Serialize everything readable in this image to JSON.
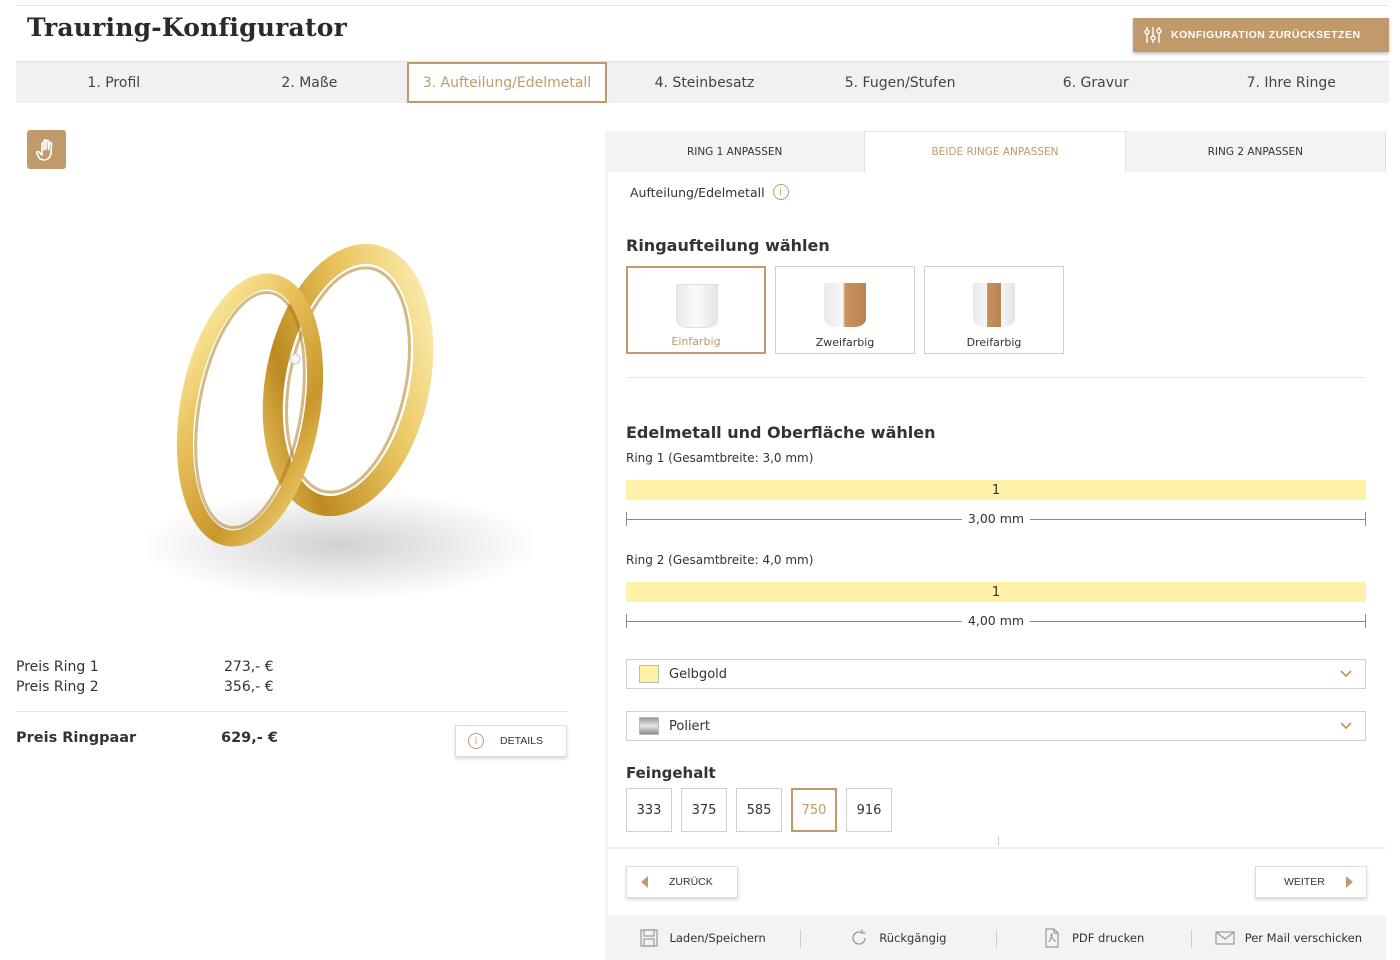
{
  "header": {
    "title": "Trauring-Konfigurator",
    "reset_label": "KONFIGURATION ZURÜCKSETZEN"
  },
  "steps": [
    {
      "label": "1. Profil",
      "active": false
    },
    {
      "label": "2. Maße",
      "active": false
    },
    {
      "label": "3. Aufteilung/Edelmetall",
      "active": true
    },
    {
      "label": "4. Steinbesatz",
      "active": false
    },
    {
      "label": "5. Fugen/Stufen",
      "active": false
    },
    {
      "label": "6. Gravur",
      "active": false
    },
    {
      "label": "7. Ihre Ringe",
      "active": false
    }
  ],
  "prices": {
    "ring1_label": "Preis Ring 1",
    "ring1_value": "273,- €",
    "ring2_label": "Preis Ring 2",
    "ring2_value": "356,- €",
    "pair_label": "Preis Ringpaar",
    "pair_value": "629,- €",
    "details_label": "DETAILS"
  },
  "tabs": [
    {
      "label": "RING 1 ANPASSEN",
      "active": false
    },
    {
      "label": "BEIDE RINGE ANPASSEN",
      "active": true
    },
    {
      "label": "RING 2 ANPASSEN",
      "active": false
    }
  ],
  "section_title": "Aufteilung/Edelmetall",
  "split": {
    "heading": "Ringaufteilung wählen",
    "options": [
      {
        "label": "Einfarbig",
        "active": true
      },
      {
        "label": "Zweifarbig",
        "active": false
      },
      {
        "label": "Dreifarbig",
        "active": false
      }
    ]
  },
  "metal": {
    "heading": "Edelmetall und Oberfläche wählen",
    "ring1_label": "Ring 1 (Gesamtbreite: 3,0 mm)",
    "ring1_segment": "1",
    "ring1_width": "3,00 mm",
    "ring2_label": "Ring 2 (Gesamtbreite: 4,0 mm)",
    "ring2_segment": "1",
    "ring2_width": "4,00 mm",
    "metal_value": "Gelbgold",
    "surface_value": "Poliert",
    "colors": {
      "gelbgold": "#fff1a8",
      "accent": "#c19a6b"
    }
  },
  "fineness": {
    "heading": "Feingehalt",
    "options": [
      "333",
      "375",
      "585",
      "750",
      "916"
    ],
    "selected": "750"
  },
  "nav": {
    "back_label": "ZURÜCK",
    "next_label": "WEITER"
  },
  "footer": {
    "load_save": "Laden/Speichern",
    "undo": "Rückgängig",
    "pdf": "PDF drucken",
    "mail": "Per Mail verschicken"
  }
}
